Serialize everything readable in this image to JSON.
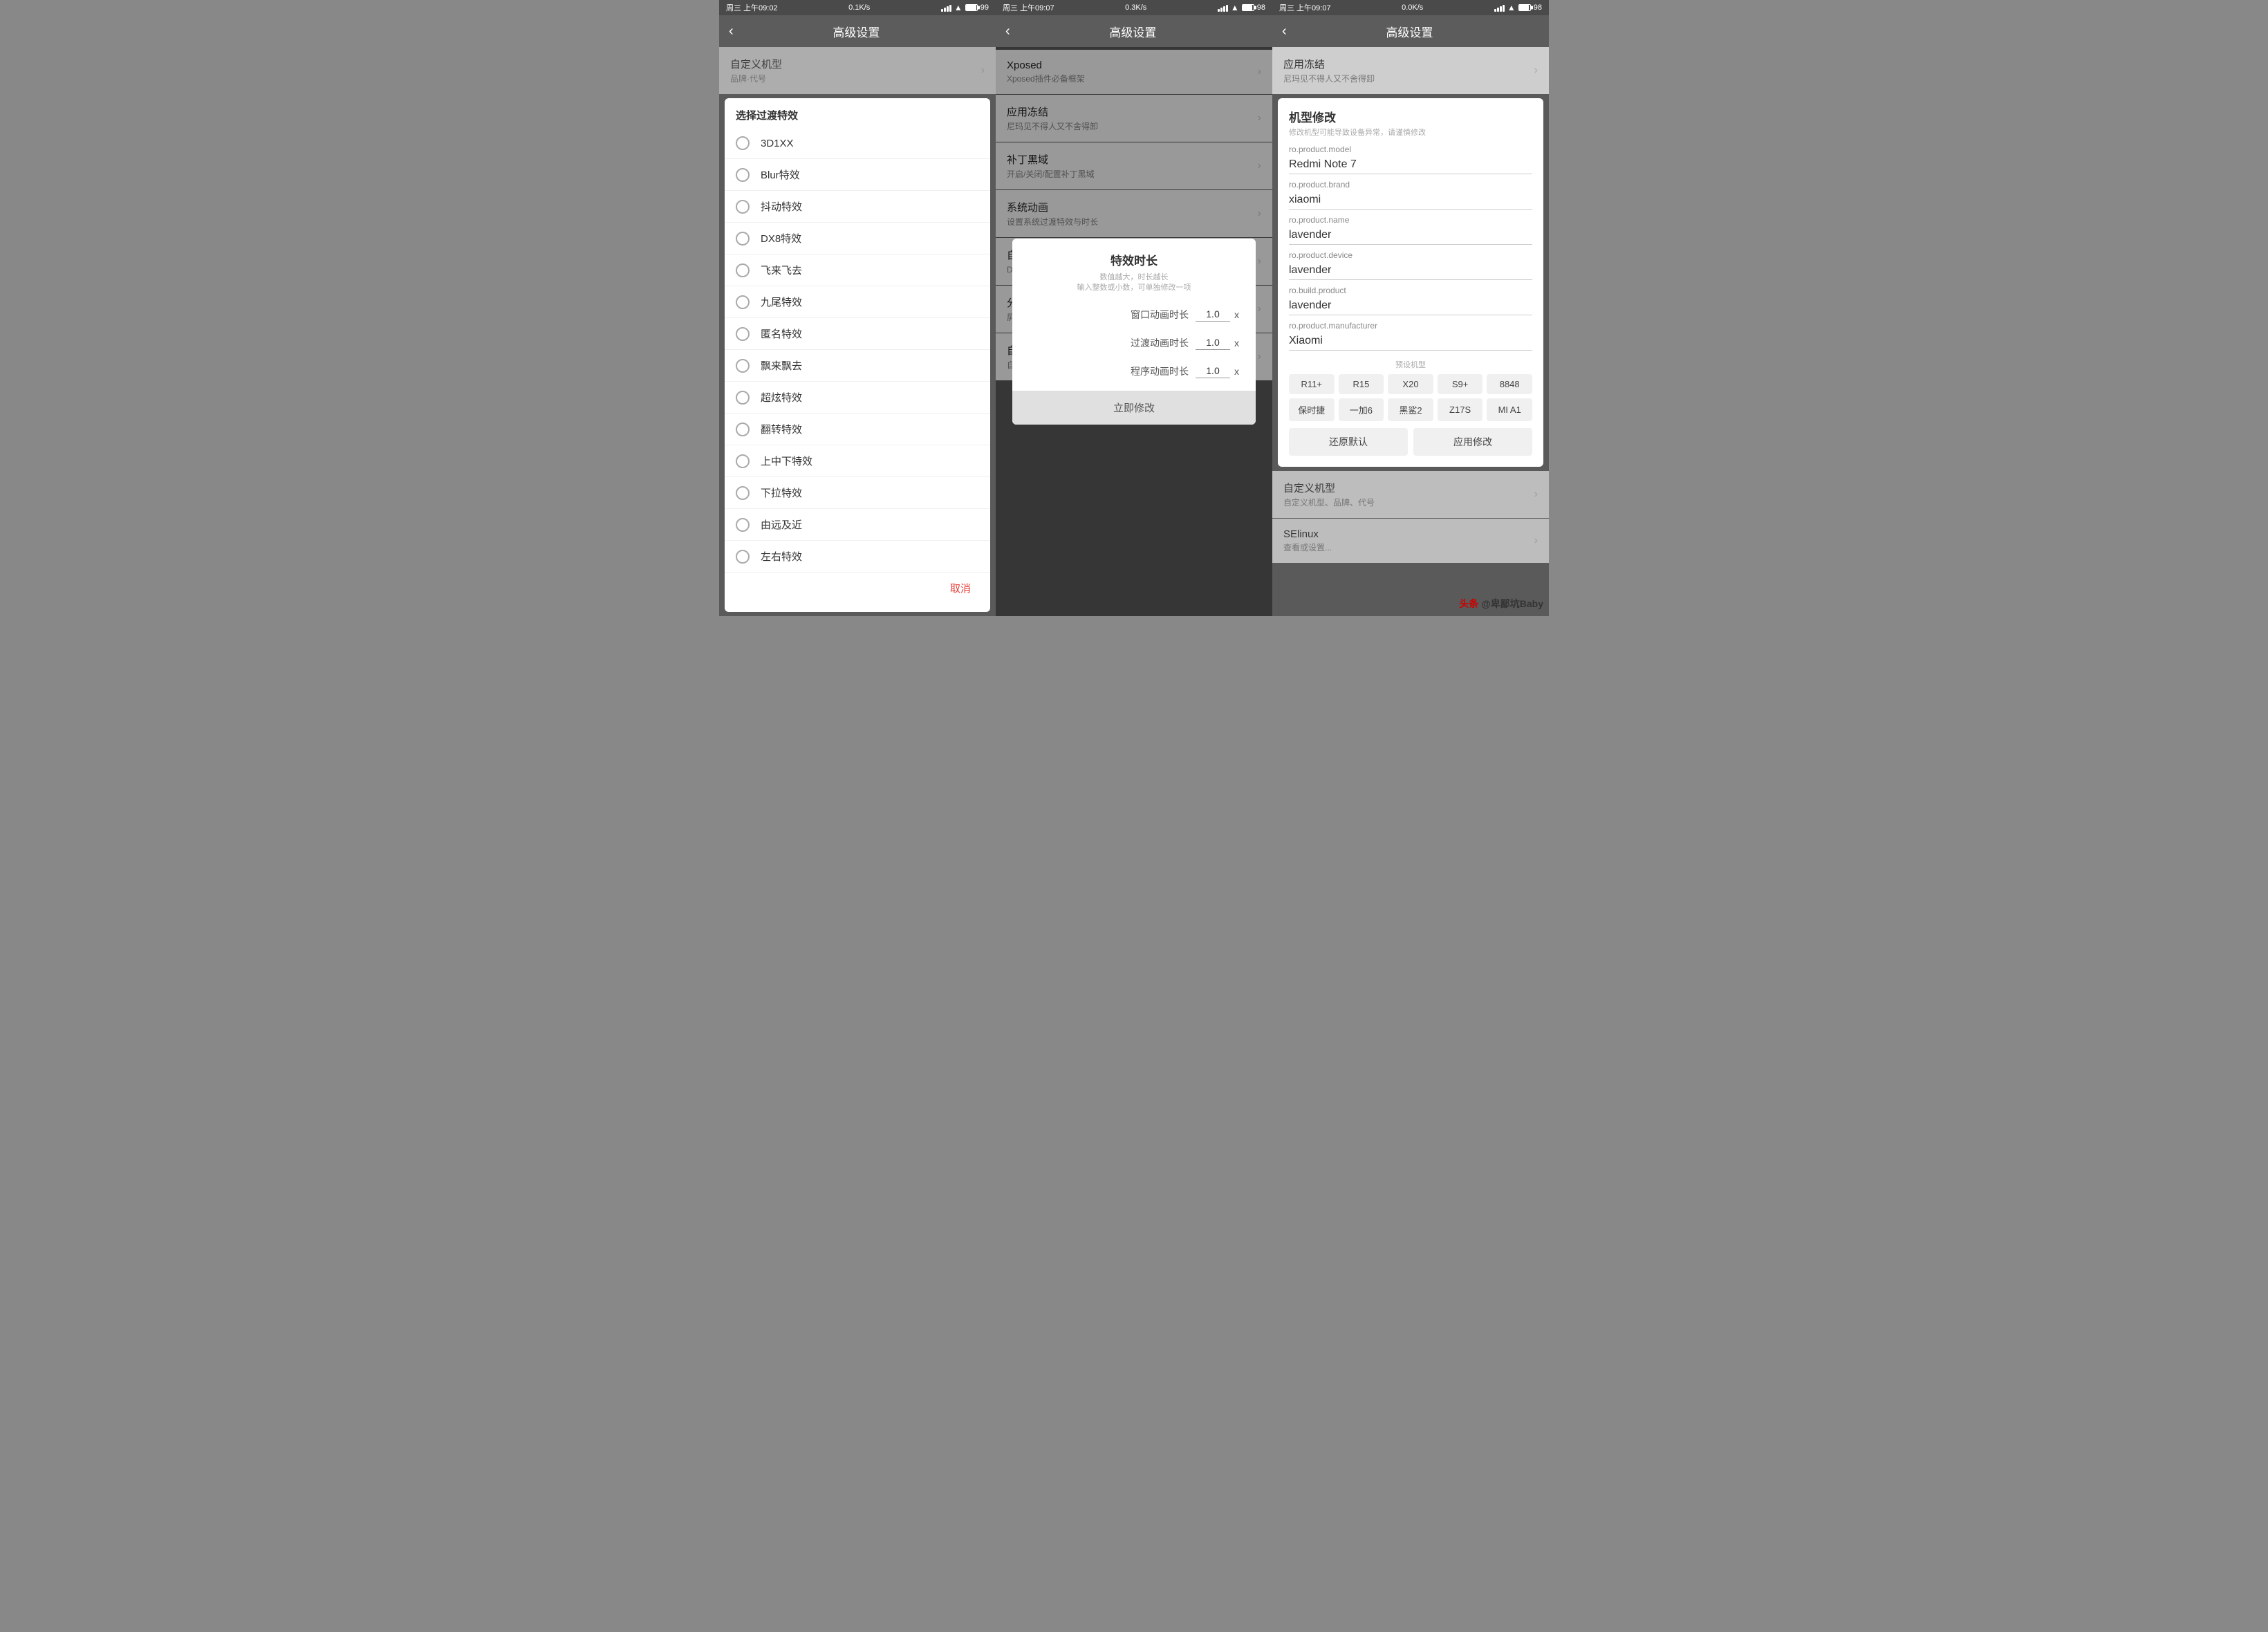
{
  "screens": [
    {
      "id": "screen1",
      "status_bar": {
        "time": "周三 上午09:02",
        "speed": "0.1K/s",
        "battery": "99"
      },
      "top_bar": {
        "back": "‹",
        "title": "高级设置"
      },
      "dialog": {
        "title": "选择过渡特效",
        "items": [
          {
            "text": "3D1XX",
            "selected": false
          },
          {
            "text": "Blur特效",
            "selected": false
          },
          {
            "text": "抖动特效",
            "selected": false
          },
          {
            "text": "DX8特效",
            "selected": false
          },
          {
            "text": "飞来飞去",
            "selected": false
          },
          {
            "text": "九尾特效",
            "selected": false
          },
          {
            "text": "匿名特效",
            "selected": false
          },
          {
            "text": "飘来飘去",
            "selected": false
          },
          {
            "text": "超炫特效",
            "selected": false
          },
          {
            "text": "翻转特效",
            "selected": false
          },
          {
            "text": "上中下特效",
            "selected": false
          },
          {
            "text": "下拉特效",
            "selected": false
          },
          {
            "text": "由远及近",
            "selected": false
          },
          {
            "text": "左右特效",
            "selected": false
          }
        ],
        "cancel_label": "取消"
      },
      "bg_items": [
        {
          "title": "自定义机型",
          "subtitle": "品牌·代号"
        }
      ]
    },
    {
      "id": "screen2",
      "status_bar": {
        "time": "周三 上午09:07",
        "speed": "0.3K/s",
        "battery": "98"
      },
      "top_bar": {
        "back": "‹",
        "title": "高级设置"
      },
      "settings_items": [
        {
          "title": "Xposed",
          "subtitle": "Xposed插件必备框架"
        },
        {
          "title": "应用冻结",
          "subtitle": "尼玛见不得人又不舍得卸"
        },
        {
          "title": "补丁黑域",
          "subtitle": "开启/关闭/配置补丁黑域"
        },
        {
          "title": "系统动画",
          "subtitle": "设置系统过渡特效与时长"
        },
        {
          "title": "自定义DPI",
          "subtitle": "DPI值越小可视范围越大"
        },
        {
          "title": "分辨率修改",
          "subtitle": "屏幕分辨率越小越流畅"
        },
        {
          "title": "自定义机型",
          "subtitle": "自定义机型、品牌、代号"
        }
      ],
      "dialog": {
        "title": "特效时长",
        "subtitle_line1": "数值越大，时长越长",
        "subtitle_line2": "输入整数或小数，可单独修改一项",
        "fields": [
          {
            "label": "窗口动画时长",
            "value": "1.0",
            "suffix": "x"
          },
          {
            "label": "过渡动画时长",
            "value": "1.0",
            "suffix": "x"
          },
          {
            "label": "程序动画时长",
            "value": "1.0",
            "suffix": "x"
          }
        ],
        "confirm_label": "立即修改"
      }
    },
    {
      "id": "screen3",
      "status_bar": {
        "time": "周三 上午09:07",
        "speed": "0.0K/s",
        "battery": "98"
      },
      "top_bar": {
        "back": "‹",
        "title": "高级设置"
      },
      "bg_items_top": [
        {
          "title": "应用冻结",
          "subtitle": "尼玛见不得人又不舍得卸"
        }
      ],
      "dialog": {
        "title": "机型修改",
        "subtitle": "修改机型可能导致设备异常，请谨慎修改",
        "fields": [
          {
            "label": "ro.product.model",
            "value": "Redmi Note 7"
          },
          {
            "label": "ro.product.brand",
            "value": "xiaomi"
          },
          {
            "label": "ro.product.name",
            "value": "lavender"
          },
          {
            "label": "ro.product.device",
            "value": "lavender"
          },
          {
            "label": "ro.build.product",
            "value": "lavender"
          },
          {
            "label": "ro.product.manufacturer",
            "value": "Xiaomi"
          }
        ],
        "presets_label": "预设机型",
        "presets": [
          "R11+",
          "R15",
          "X20",
          "S9+",
          "8848",
          "保时捷",
          "一加6",
          "黑鲨2",
          "Z17S",
          "MI A1"
        ],
        "actions": [
          {
            "label": "还原默认"
          },
          {
            "label": "应用修改"
          }
        ]
      },
      "bg_items_bottom": [
        {
          "title": "自定义机型",
          "subtitle": "自定义机型、品牌、代号"
        },
        {
          "title": "SElinux",
          "subtitle": "查看或设置..."
        }
      ]
    }
  ],
  "watermark": "头条 @卑鄙坑Baby"
}
